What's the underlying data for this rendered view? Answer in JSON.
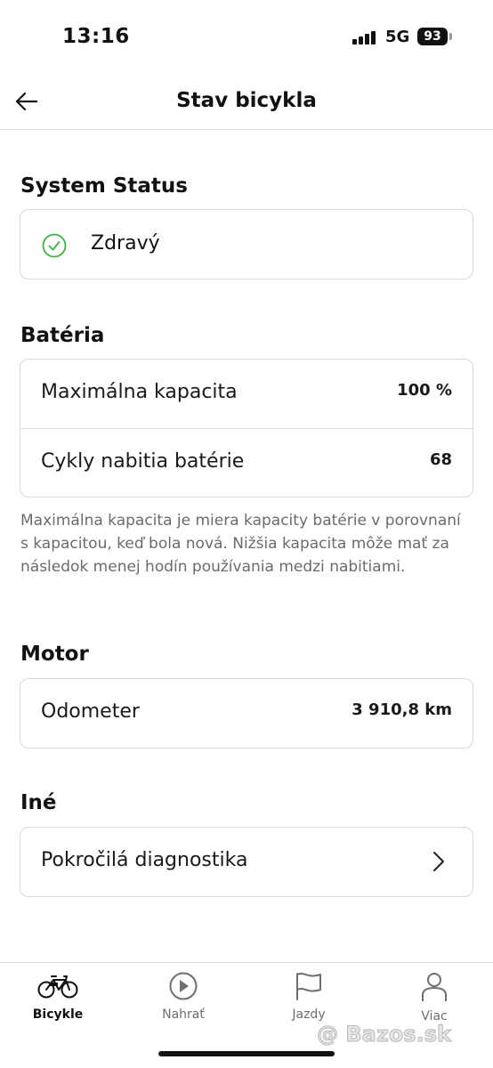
{
  "status_bar": {
    "time": "13:16",
    "network": "5G",
    "battery_level": "93"
  },
  "header": {
    "title": "Stav bicykla",
    "back_icon": "arrow-left-icon"
  },
  "system_status": {
    "title": "System Status",
    "state": "Zdravý",
    "icon": "check-circle-icon",
    "icon_color": "#3cb53c"
  },
  "battery": {
    "title": "Batéria",
    "rows": [
      {
        "label": "Maximálna kapacita",
        "value": "100 %"
      },
      {
        "label": "Cykly nabitia batérie",
        "value": "68"
      }
    ],
    "note": "Maximálna kapacita je miera kapacity batérie v porovnaní s kapacitou, keď bola nová. Nižšia kapacita môže mať za následok menej hodín používania medzi nabitiami."
  },
  "motor": {
    "title": "Motor",
    "rows": [
      {
        "label": "Odometer",
        "value": "3 910,8 km"
      }
    ]
  },
  "other": {
    "title": "Iné",
    "rows": [
      {
        "label": "Pokročilá diagnostika",
        "icon": "chevron-right-icon"
      }
    ]
  },
  "tabs": [
    {
      "label": "Bicykle",
      "icon": "bicycle-icon",
      "active": true
    },
    {
      "label": "Nahrať",
      "icon": "play-circle-icon",
      "active": false
    },
    {
      "label": "Jazdy",
      "icon": "flag-icon",
      "active": false
    },
    {
      "label": "Viac",
      "icon": "person-icon",
      "active": false
    }
  ],
  "watermark": "@ Bazos.sk"
}
